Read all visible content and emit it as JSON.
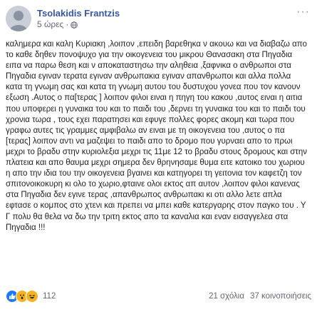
{
  "post": {
    "author": "Tsolakidis Frantzis",
    "time": "5 ώρες",
    "time_separator": "·",
    "privacy_icon": "globe-icon",
    "menu_icon": "more-options-icon",
    "text": "καλημερα και καλη Κυριακη ,λοιπον ,επειδη βαρεθηκα ν ακουω και να διαβαζω απο το καθε δηθεν πονοψυχο για την οικογενεια του μικρου Θανασακη στα Πηγαδια ειπα να παρω θεση και ν αποκαταστησω την αληθεια ,ξαφνικα ο ανθρωποι στα Πηγαδια εγιναν τερατα εγιναν ανθρωπακια εγιναν απανθρωποι και αλλα πολλα κατα τη γνωμη σας και κατα τη γνωμη αυτου του δυστυχου γονεα που τον κανουν εξωση .Αυτος ο πα[τερας ] λοιπον φιλοι ειναι η πηγη του κακου ,αυτος ειναι η αιτια που υποφερει η γυναικα του και το παιδι του ,δερνει τη γυναικα του και το παιδι του χρονια τωρα , τους εχει παρατησει και εφυγε πολλες φορες ακομη και τωρα που γραφω αυτες τις γραμμες αμφιβαλω αν ειναι με τη οικογενεια του ,αυτος ο πα [τερας] λοιπον αντι να μαζεψει το παιδι απο το δρομο που γυρναει απο το πρωι μεχρι το βραδυ στην κυριολεξια μεχρι τις 11με 12 το βραδυ στους δρομους και στην πλατεια και απο θαυμα μεχρι σημερα δεν θρηνησαμε θυμα ειτε κατοικο του χωριου η απο την ιδια του την οικογενεια βγαινει και κατηγορει τη γειτονια τον καφετζη τον σπιτονοικοκυρη κι ολο το χωριο,φταινε ολοι εκτος απ αυτον ,λοιπον φιλοι κανενας στα Πηγαδια δεν εγινε τερας ,απανθρωπος ανθρωπακι κι οτι αλλο λετε απλα εφτασε ο κομπος στο χτενι και πρεπει να μπει καθε κατεργαρης στον παγκο του . Υ Γ πολυ θα θελα να δω την τριτη εκτος απο τα καναλια και εναν εισαγγελεα στα Πηγαδια !!!",
    "reaction_icons": [
      "like-icon",
      "wow-icon",
      "haha-icon"
    ],
    "reactions_count": "112",
    "comments": "21 σχόλια",
    "shares": "37 κοινοποιήσεις"
  }
}
